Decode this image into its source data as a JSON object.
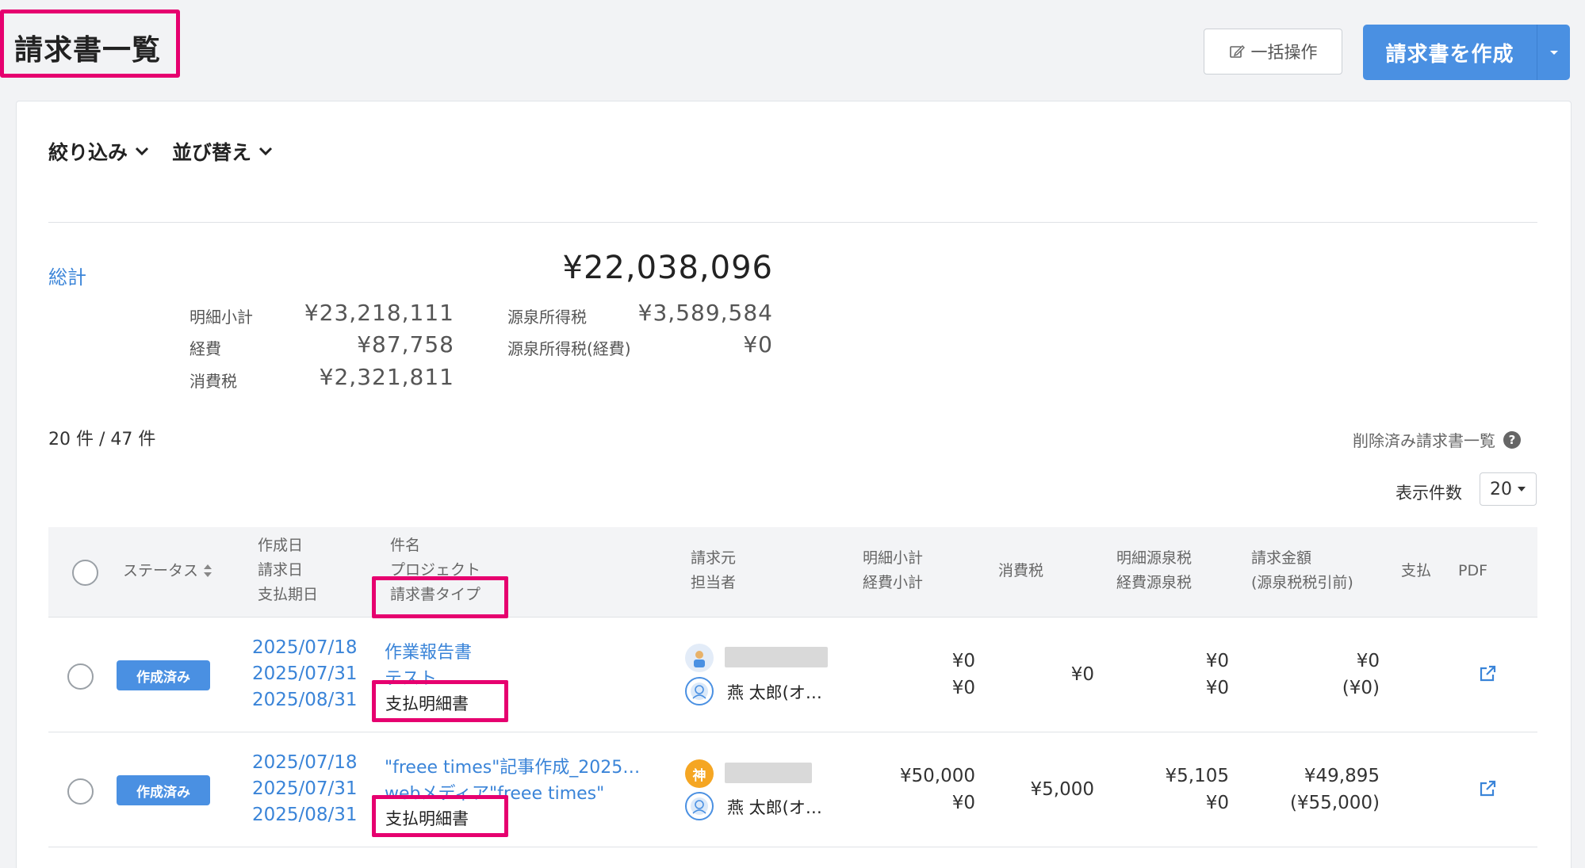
{
  "header": {
    "title": "請求書一覧",
    "bulk_label": "一括操作",
    "create_label": "請求書を作成"
  },
  "filters": {
    "filter_label": "絞り込み",
    "sort_label": "並び替え"
  },
  "summary": {
    "label": "総計",
    "total": "¥22,038,096",
    "items": {
      "meisai_label": "明細小計",
      "meisai_value": "¥23,218,111",
      "keihi_label": "経費",
      "keihi_value": "¥87,758",
      "tax_label": "消費税",
      "tax_value": "¥2,321,811",
      "withholding_label": "源泉所得税",
      "withholding_value": "¥3,589,584",
      "withholding_exp_label": "源泉所得税(経費)",
      "withholding_exp_value": "¥0"
    }
  },
  "list_meta": {
    "count": "20 件 / 47 件",
    "deleted_link": "削除済み請求書一覧",
    "help_icon": "?",
    "per_page_label": "表示件数",
    "per_page_value": "20"
  },
  "table": {
    "headers": {
      "status": "ステータス",
      "created": "作成日",
      "invoice_date": "請求日",
      "due_date": "支払期日",
      "subject": "件名",
      "project": "プロジェクト",
      "type": "請求書タイプ",
      "issuer": "請求元",
      "owner": "担当者",
      "subtotal": "明細小計",
      "exp_subtotal": "経費小計",
      "tax": "消費税",
      "withholding": "明細源泉税",
      "exp_withholding": "経費源泉税",
      "amount": "請求金額",
      "amount_note": "(源泉税税引前)",
      "payment": "支払",
      "pdf": "PDF"
    },
    "rows": [
      {
        "status": "作成済み",
        "created": "2025/07/18",
        "invoice_date": "2025/07/31",
        "due_date": "2025/08/31",
        "subject": "作業報告書",
        "project": "テスト",
        "type": "支払明細書",
        "owner": "燕 太郎(オ…",
        "subtotal": "¥0",
        "exp_subtotal": "¥0",
        "tax": "¥0",
        "withholding": "¥0",
        "exp_withholding": "¥0",
        "amount": "¥0",
        "amount_note": "(¥0)"
      },
      {
        "status": "作成済み",
        "created": "2025/07/18",
        "invoice_date": "2025/07/31",
        "due_date": "2025/08/31",
        "subject": "\"freee times\"記事作成_2025…",
        "project": "webメディア\"freee times\"",
        "type": "支払明細書",
        "issuer_badge": "神",
        "owner": "燕 太郎(オ…",
        "subtotal": "¥50,000",
        "exp_subtotal": "¥0",
        "tax": "¥5,000",
        "withholding": "¥5,105",
        "exp_withholding": "¥0",
        "amount": "¥49,895",
        "amount_note": "(¥55,000)"
      }
    ]
  },
  "colors": {
    "accent": "#4a90e2",
    "highlight": "#e6006f",
    "link": "#3a84d8"
  }
}
